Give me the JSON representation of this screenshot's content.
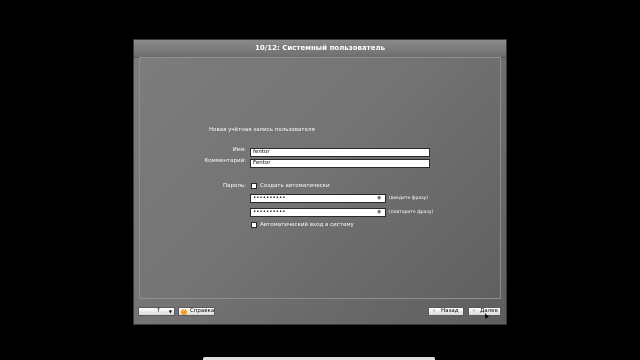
{
  "window": {
    "title": "10/12: Системный пользователь"
  },
  "form": {
    "section_title": "Новая учётная запись пользователя",
    "name_label": "Имя:",
    "name_value": "fentor",
    "comment_label": "Комментарий:",
    "comment_value": "Fentor",
    "password_label": "Пароль:",
    "auto_create_label": "Создать автоматически",
    "password_value": "••••••••••",
    "password_confirm_value": "••••••••••",
    "password_hint": "(введите фразу)",
    "password_confirm_hint": "(повторите фразу)",
    "autologin_label": "Автоматический вход в систему"
  },
  "bottom": {
    "lang_label": "↑",
    "help_label": "Справка",
    "back_label": "Назад",
    "next_label": "Далее"
  },
  "icons": {
    "eye": "eye-icon",
    "help": "help-icon",
    "arrow_left": "arrow-left-icon",
    "arrow_right": "arrow-right-icon",
    "dropdown": "chevron-down-icon"
  },
  "colors": {
    "background": "#000000",
    "window": "#747474",
    "help_accent": "#f39a1e"
  }
}
